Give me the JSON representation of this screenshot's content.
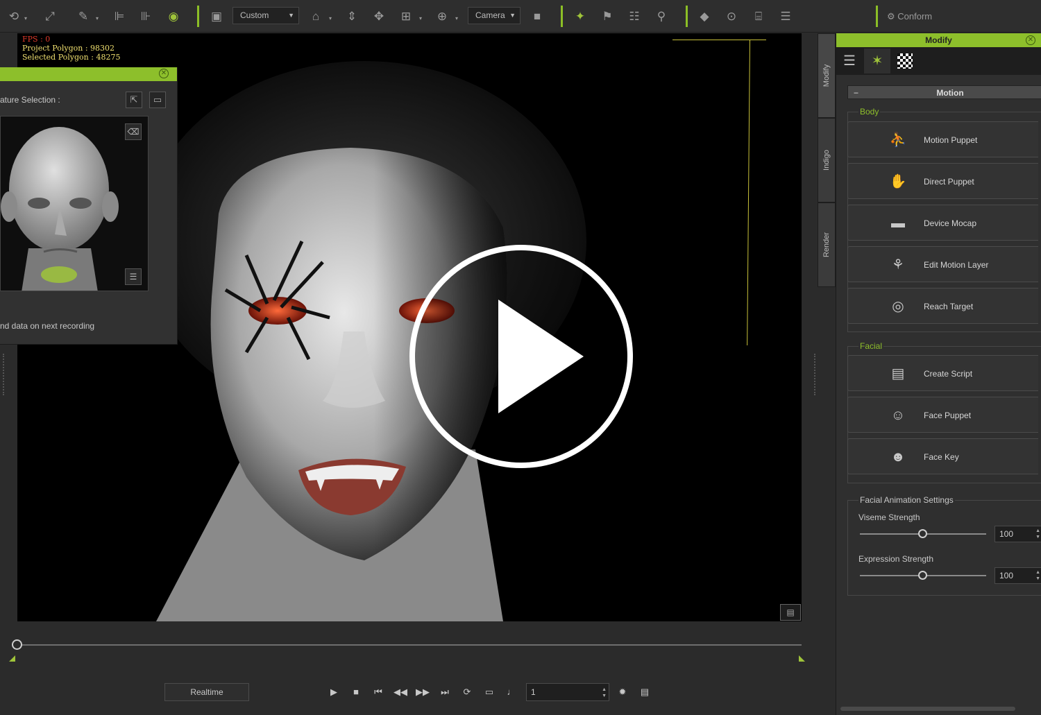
{
  "toolbar": {
    "preset_dropdown": "Custom",
    "camera_dropdown": "Camera",
    "conform_label": "Conform",
    "accent_color": "#8dbf2b"
  },
  "viewport": {
    "hud_fps": "FPS : 0",
    "hud_project_polygon": "Project Polygon : 98302",
    "hud_selected_polygon": "Selected Polygon : 48275"
  },
  "left_panel": {
    "feature_selection_label": "ature Selection :",
    "record_text": "nd data on next  recording"
  },
  "side_tabs": [
    "Modify",
    "Indigo",
    "Render"
  ],
  "modify_panel": {
    "title": "Modify",
    "section_title": "Motion",
    "body_group_label": "Body",
    "body_buttons": [
      {
        "label": "Motion Puppet",
        "icon": "motion-puppet-icon"
      },
      {
        "label": "Direct Puppet",
        "icon": "direct-puppet-icon"
      },
      {
        "label": "Device Mocap",
        "icon": "device-mocap-icon"
      },
      {
        "label": "Edit Motion Layer",
        "icon": "edit-motion-layer-icon"
      },
      {
        "label": "Reach Target",
        "icon": "reach-target-icon"
      }
    ],
    "facial_group_label": "Facial",
    "facial_buttons": [
      {
        "label": "Create Script",
        "icon": "create-script-icon"
      },
      {
        "label": "Face Puppet",
        "icon": "face-puppet-icon"
      },
      {
        "label": "Face Key",
        "icon": "face-key-icon"
      }
    ],
    "facial_settings_label": "Facial Animation Settings",
    "viseme_label": "Viseme Strength",
    "viseme_value": "100",
    "viseme_level": 0.5,
    "expression_label": "Expression Strength",
    "expression_value": "100",
    "expression_level": 0.5
  },
  "playback": {
    "realtime_label": "Realtime",
    "frame_value": "1"
  }
}
